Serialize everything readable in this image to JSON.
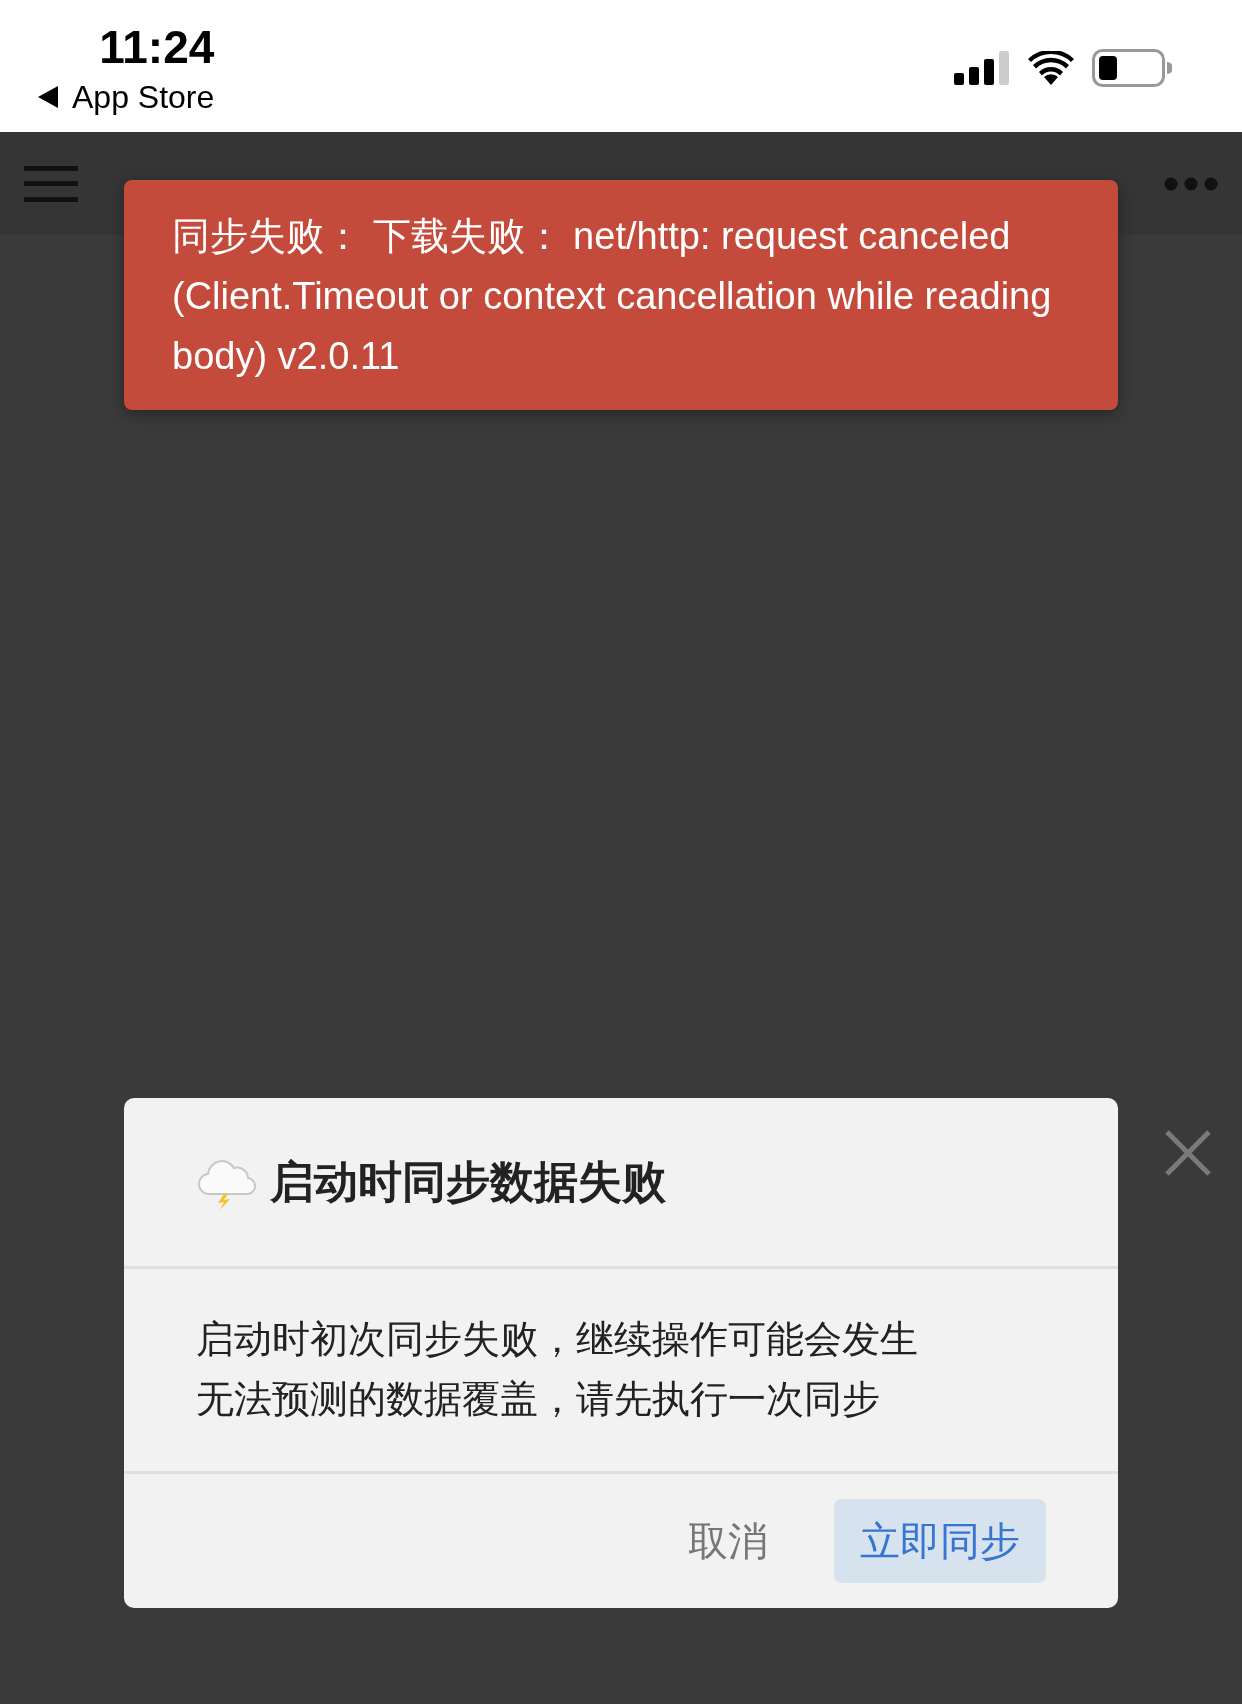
{
  "status_bar": {
    "time": "11:24",
    "back_label": "App Store"
  },
  "toast": {
    "text": "同步失败： 下载失败： net/http: request canceled (Client.Timeout or context cancellation while reading body) v2.0.11"
  },
  "dialog": {
    "title": "启动时同步数据失败",
    "message": "启动时初次同步失败，继续操作可能会发生无法预测的数据覆盖，请先执行一次同步",
    "buttons": [
      {
        "label": "取消",
        "kind": "secondary"
      },
      {
        "label": "立即同步",
        "kind": "primary"
      }
    ]
  }
}
